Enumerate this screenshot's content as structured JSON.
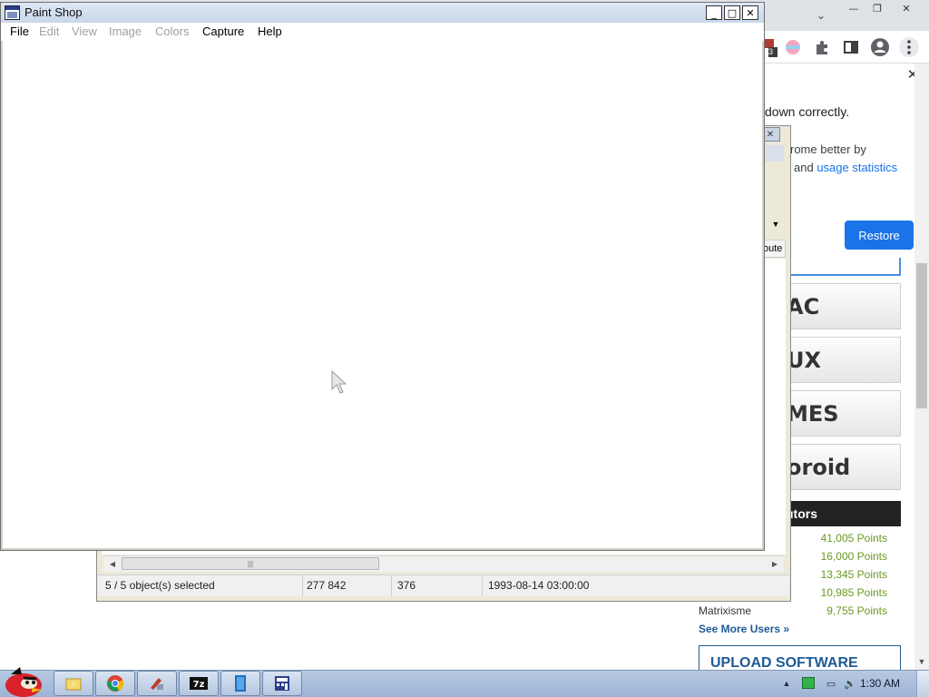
{
  "paint_window": {
    "title": "Paint Shop",
    "controls": {
      "minimize": "_",
      "maximize": "□",
      "close": "✕"
    },
    "menu": [
      {
        "label": "File",
        "enabled": true
      },
      {
        "label": "Edit",
        "enabled": false
      },
      {
        "label": "View",
        "enabled": false
      },
      {
        "label": "Image",
        "enabled": false
      },
      {
        "label": "Colors",
        "enabled": false
      },
      {
        "label": "Capture",
        "enabled": true
      },
      {
        "label": "Help",
        "enabled": true
      }
    ]
  },
  "explorer_window": {
    "column_header_partial": "oute",
    "status": {
      "selection": "5 / 5 object(s) selected",
      "size": "277 842",
      "count": "376",
      "date": "1993-08-14 03:00:00"
    }
  },
  "browser": {
    "window_controls": {
      "minimize": "—",
      "restore": "❐",
      "close": "✕"
    },
    "toolbar_icons": [
      "extension-badge-icon",
      "profile-color-icon",
      "extensions-puzzle-icon",
      "side-panel-icon",
      "account-avatar-icon",
      "menu-kebab-icon"
    ],
    "extension_badge_count": "3",
    "restore_bubble": {
      "message_partial": "down correctly.",
      "sub_line1_partial": "rome better by",
      "sub_line2_prefix": "and ",
      "sub_line2_link": "usage statistics",
      "button_label": "Restore"
    },
    "os_tiles": [
      "AC",
      "UX",
      "MES",
      "oroid"
    ],
    "contributors": {
      "header_partial": "utors",
      "points": [
        "41,005 Points",
        "16,000 Points",
        "13,345 Points",
        "10,985 Points",
        "9,755 Points"
      ],
      "last_name": "Matrixisme",
      "see_more": "See More Users »"
    },
    "upload_label": "UPLOAD SOFTWARE"
  },
  "taskbar": {
    "clock": "1:30 AM",
    "buttons": [
      "explorer-folder-icon",
      "chrome-icon",
      "paint-tool-icon",
      "7zip-icon",
      "notebook-app-icon",
      "calculator-app-icon"
    ]
  },
  "colors": {
    "accent_blue": "#1a73e8",
    "points_green": "#6a9a1f",
    "link_blue": "#1f5a96"
  }
}
